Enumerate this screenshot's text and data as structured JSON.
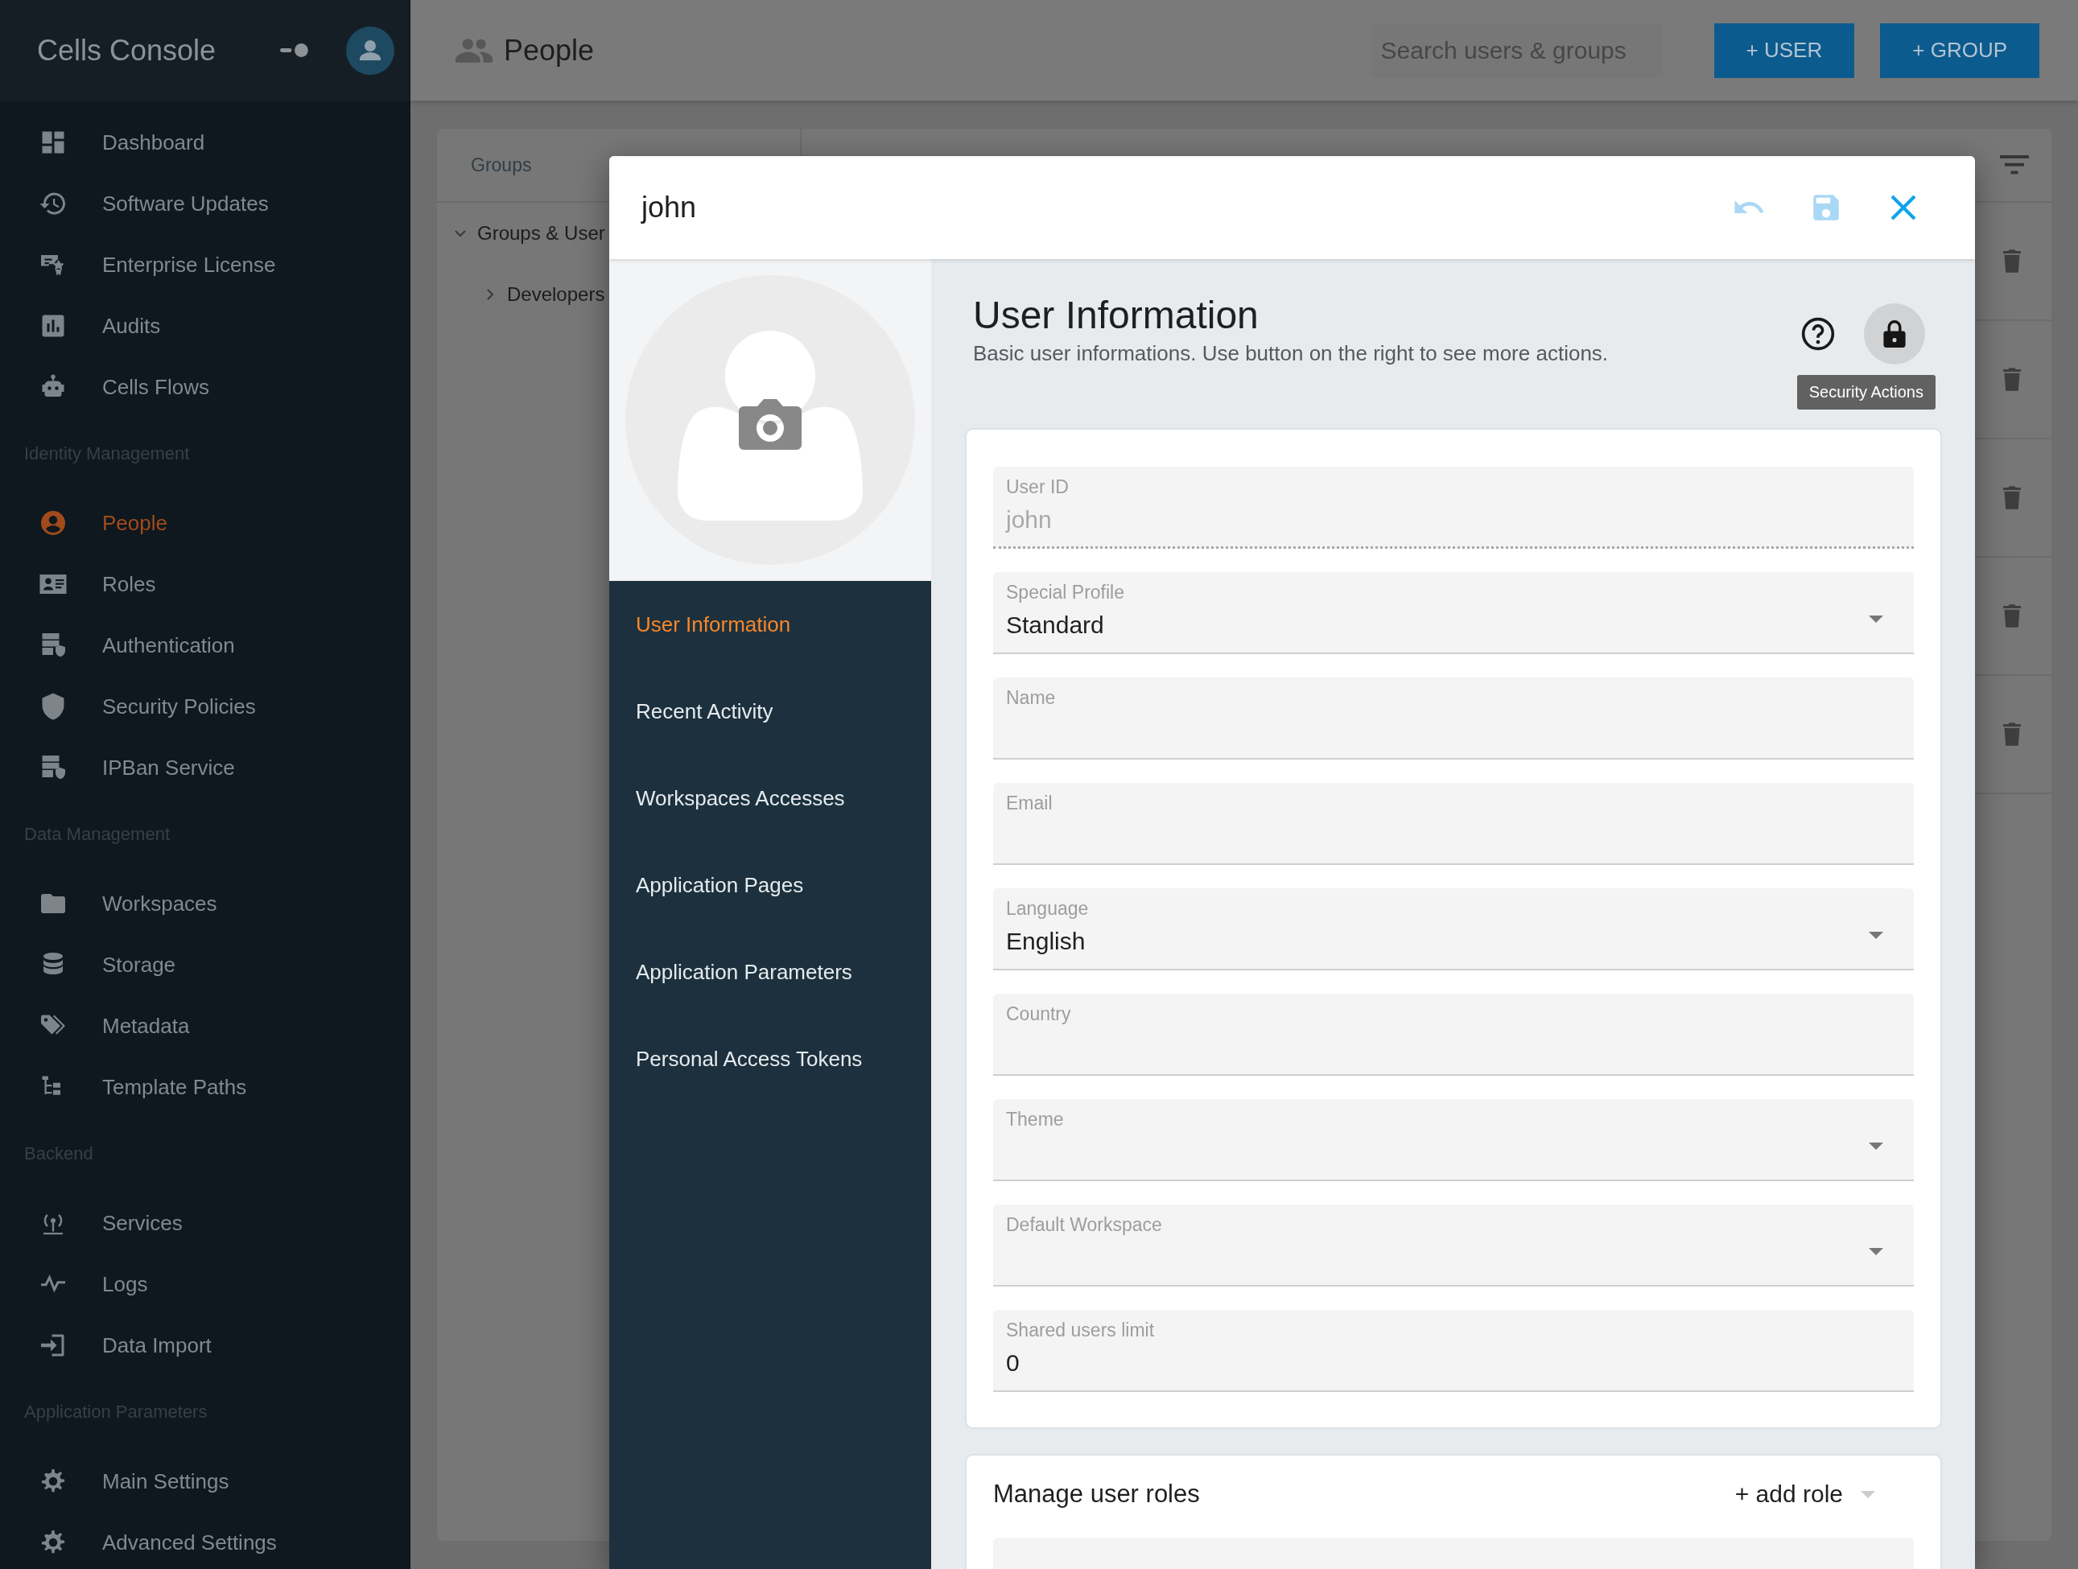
{
  "sidebar": {
    "title": "Cells Console",
    "sections": [
      {
        "items": [
          {
            "label": "Dashboard",
            "selected": false
          },
          {
            "label": "Software Updates",
            "selected": false
          },
          {
            "label": "Enterprise License",
            "selected": false
          },
          {
            "label": "Audits",
            "selected": false
          },
          {
            "label": "Cells Flows",
            "selected": false
          }
        ]
      },
      {
        "heading": "Identity Management",
        "items": [
          {
            "label": "People",
            "selected": true
          },
          {
            "label": "Roles",
            "selected": false
          },
          {
            "label": "Authentication",
            "selected": false
          },
          {
            "label": "Security Policies",
            "selected": false
          },
          {
            "label": "IPBan Service",
            "selected": false
          }
        ]
      },
      {
        "heading": "Data Management",
        "items": [
          {
            "label": "Workspaces",
            "selected": false
          },
          {
            "label": "Storage",
            "selected": false
          },
          {
            "label": "Metadata",
            "selected": false
          },
          {
            "label": "Template Paths",
            "selected": false
          }
        ]
      },
      {
        "heading": "Backend",
        "items": [
          {
            "label": "Services",
            "selected": false
          },
          {
            "label": "Logs",
            "selected": false
          },
          {
            "label": "Data Import",
            "selected": false
          }
        ]
      },
      {
        "heading": "Application Parameters",
        "items": [
          {
            "label": "Main Settings",
            "selected": false
          },
          {
            "label": "Advanced Settings",
            "selected": false
          }
        ]
      }
    ]
  },
  "header": {
    "title": "People",
    "search": {
      "placeholder": "Search users & groups"
    },
    "buttons": [
      "+ USER",
      "+ GROUP"
    ]
  },
  "groups_panel": {
    "heading": "Groups",
    "tree": [
      {
        "label": "Groups & User",
        "expanded": true,
        "children": [
          {
            "label": "Developers",
            "expanded": false
          }
        ]
      }
    ]
  },
  "dialog": {
    "title": "john",
    "nav": [
      {
        "label": "User Information",
        "selected": true
      },
      {
        "label": "Recent Activity",
        "selected": false
      },
      {
        "label": "Workspaces Accesses",
        "selected": false
      },
      {
        "label": "Application Pages",
        "selected": false
      },
      {
        "label": "Application Parameters",
        "selected": false
      },
      {
        "label": "Personal Access Tokens",
        "selected": false
      }
    ],
    "section": {
      "title": "User Information",
      "description": "Basic user informations. Use button on the right to see more actions.",
      "tooltip": "Security Actions"
    },
    "fields": [
      {
        "label": "User ID",
        "value": "john",
        "kind": "text",
        "disabled": true
      },
      {
        "label": "Special Profile",
        "value": "Standard",
        "kind": "select",
        "disabled": false
      },
      {
        "label": "Name",
        "kind": "text",
        "disabled": false
      },
      {
        "label": "Email",
        "kind": "text",
        "disabled": false
      },
      {
        "label": "Language",
        "value": "English",
        "kind": "select",
        "disabled": false
      },
      {
        "label": "Country",
        "kind": "text",
        "disabled": false
      },
      {
        "label": "Theme",
        "kind": "select",
        "disabled": false
      },
      {
        "label": "Default Workspace",
        "kind": "select",
        "disabled": false
      },
      {
        "label": "Shared users limit",
        "value": "0",
        "kind": "text",
        "disabled": false
      }
    ],
    "roles": {
      "title": "Manage user roles",
      "add_label": "+ add role"
    }
  }
}
